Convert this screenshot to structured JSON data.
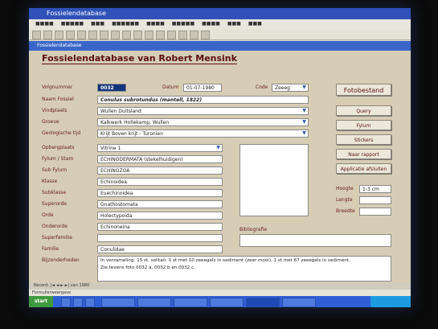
{
  "window": {
    "title": "Fossielendatabase"
  },
  "form_window": {
    "title": "Fossielendatabase"
  },
  "form": {
    "heading": "Fossielendatabase van Robert Mensink",
    "volgnummer": {
      "label": "Volgnummer",
      "value": "0032"
    },
    "datum": {
      "label": "Datum",
      "value": "01-07-1980"
    },
    "code": {
      "label": "Code",
      "value": "Zeeeg"
    },
    "naam": {
      "label": "Naam Fossiel",
      "value": "Conulus subrotundus (mantell, 1822)"
    },
    "vindplaats": {
      "label": "Vindplaats",
      "value": "Wullen Duitsland"
    },
    "groeve": {
      "label": "Groeve",
      "value": "Kalkwerk Hollekamp, Wullen"
    },
    "tijd": {
      "label": "Geologische tijd",
      "value": "Krijt Boven krijt - Turonien"
    },
    "opbergplaats": {
      "label": "Opbergplaats",
      "value": "Vitrine 1"
    },
    "fylum": {
      "label": "Fylum / Stam",
      "value": "ECHINODERMATA (stekelhuidigen)"
    },
    "subfylum": {
      "label": "Sub Fylum",
      "value": "ECHINOZOA"
    },
    "klasse": {
      "label": "Klasse",
      "value": "Echinoidea"
    },
    "subklasse": {
      "label": "Subklasse",
      "value": "Euechinoidea"
    },
    "superorde": {
      "label": "Superorde",
      "value": "Gnathostomata"
    },
    "orde": {
      "label": "Orde",
      "value": "Holectypoida"
    },
    "onderorde": {
      "label": "Onderorde",
      "value": "Echinoneina"
    },
    "superfamilie": {
      "label": "Superfamilie",
      "value": ""
    },
    "familie": {
      "label": "Familie",
      "value": "Conulidae"
    },
    "bijzonderheden": {
      "label": "Bijzonderheden",
      "line1": "In verzameling: 15 st. solitair. 1 st met 10 zeeegels in sediment (zeer mooi). 1 st met 67 zeeegels in sediment.",
      "line2": "Zie tevens foto 0032 a, 0032 b en 0032 c."
    },
    "bibliografie": {
      "label": "Bibliografie",
      "value": ""
    },
    "hoogte": {
      "label": "Hoogte",
      "value": "1-3 cm"
    },
    "lengte": {
      "label": "Lengte",
      "value": ""
    },
    "breedte": {
      "label": "Breedte",
      "value": ""
    },
    "buttons": {
      "fotobestand": "Fotobestand",
      "query": "Query",
      "fylum": "Fylum",
      "stickers": "Stickers",
      "naar_rapport": "Naar rapport",
      "applicatie_afsluiten": "Applicatie afsluiten"
    }
  },
  "navigation": {
    "record_label": "Record:",
    "record_total": "van 1980"
  },
  "status": {
    "text": "Formulierweergave"
  },
  "taskbar": {
    "start_label": "start"
  }
}
